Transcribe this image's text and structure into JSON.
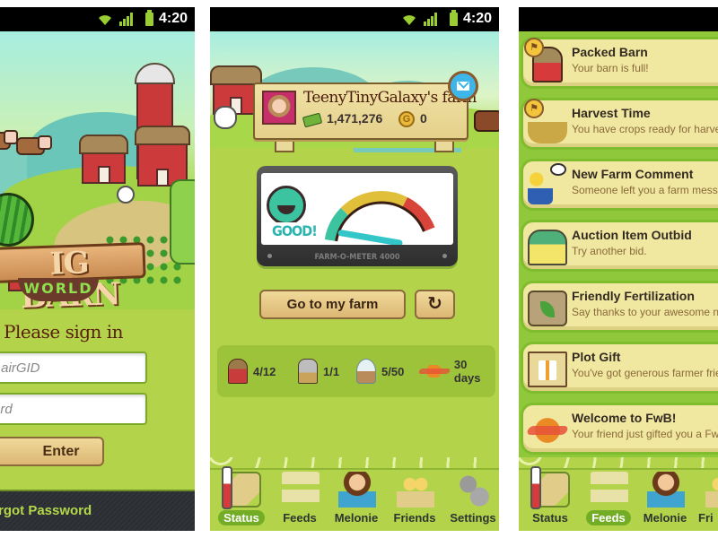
{
  "statusbar": {
    "time": "4:20"
  },
  "login": {
    "logo_text": "IG BARN",
    "logo_subtitle": "WORLD",
    "title": "Please sign in",
    "id_placeholder": "r airGID",
    "password_placeholder": "ord",
    "enter_label": "Enter",
    "forgot_label": "rgot Password"
  },
  "status": {
    "farm_name": "TeenyTinyGalaxy's farm",
    "cash": "1,471,276",
    "coins": "0",
    "coin_symbol": "G",
    "meter": {
      "label": "FARM-O-METER 4000",
      "rating": "GOOD!",
      "level_fraction": 0.08,
      "colors": {
        "good": "#3cc3a0",
        "ok": "#e0c03a",
        "bad": "#d9443a",
        "needle": "#33c6c9"
      }
    },
    "go_farm_label": "Go to my farm",
    "refresh_glyph": "↻",
    "stats": [
      {
        "icon": "barn-icon",
        "value": "4/12"
      },
      {
        "icon": "silo-icon",
        "value": "1/1"
      },
      {
        "icon": "water-tower-icon",
        "value": "5/50"
      },
      {
        "icon": "fwb-icon",
        "value": "30 days"
      }
    ]
  },
  "tabs_status": [
    {
      "label": "Status",
      "active": true
    },
    {
      "label": "Feeds",
      "active": false
    },
    {
      "label": "Melonie",
      "active": false
    },
    {
      "label": "Friends",
      "active": false
    },
    {
      "label": "Settings",
      "active": false
    }
  ],
  "tabs_feeds": [
    {
      "label": "Status",
      "active": false
    },
    {
      "label": "Feeds",
      "active": true
    },
    {
      "label": "Melonie",
      "active": false
    },
    {
      "label": "Fri",
      "active": false
    }
  ],
  "feeds": [
    {
      "title": "Packed Barn",
      "subtitle": "Your barn is full!",
      "icon": "barn-icon",
      "flagged": true
    },
    {
      "title": "Harvest Time",
      "subtitle": "You have crops ready for harves",
      "icon": "basket-icon",
      "flagged": true
    },
    {
      "title": "New Farm Comment",
      "subtitle": "Someone left you a farm messag",
      "icon": "farmer-comment-icon",
      "flagged": false
    },
    {
      "title": "Auction Item Outbid",
      "subtitle": "Try another bid.",
      "icon": "bank-icon",
      "flagged": false
    },
    {
      "title": "Friendly Fertilization",
      "subtitle": "Say thanks to your awesome ne",
      "icon": "fertilizer-bag-icon",
      "flagged": false
    },
    {
      "title": "Plot Gift",
      "subtitle": "You've got generous farmer frien",
      "icon": "gift-icon",
      "flagged": false
    },
    {
      "title": "Welcome to FwB!",
      "subtitle": "Your friend just gifted you a FwB",
      "icon": "fwb-icon",
      "flagged": false
    }
  ],
  "flag_glyph": "⚑"
}
